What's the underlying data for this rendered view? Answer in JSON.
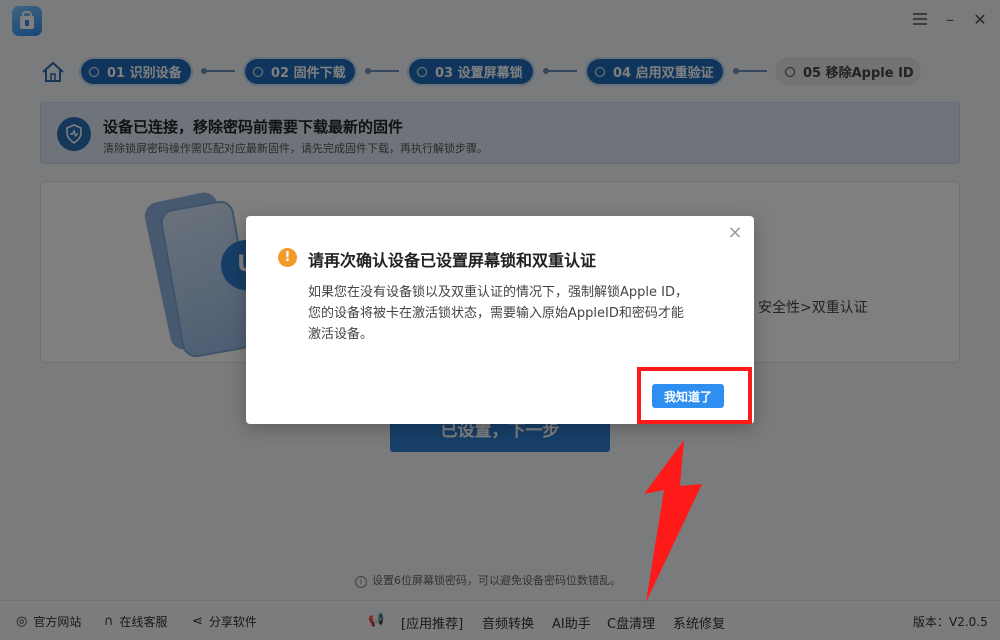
{
  "window": {
    "minimize": "–",
    "close": "✕"
  },
  "steps": [
    {
      "label": "01 识别设备",
      "state": "done"
    },
    {
      "label": "02 固件下载",
      "state": "done"
    },
    {
      "label": "03 设置屏幕锁",
      "state": "done"
    },
    {
      "label": "04 启用双重验证",
      "state": "done"
    },
    {
      "label": "05 移除Apple ID",
      "state": "todo"
    }
  ],
  "banner": {
    "title": "设备已连接，移除密码前需要下载最新的固件",
    "subtitle": "清除锁屏密码操作需匹配对应最新固件，请先完成固件下载，再执行解锁步骤。"
  },
  "card": {
    "tail_text": "安全性>双重认证"
  },
  "next_button": "已设置，下一步",
  "tip": "设置6位屏幕锁密码，可以避免设备密码位数错乱。",
  "footer": {
    "official_site": "官方网站",
    "online_support": "在线客服",
    "share": "分享软件",
    "recommend": "[应用推荐]",
    "audio_convert": "音频转换",
    "ai_assistant": "AI助手",
    "c_clean": "C盘清理",
    "system_repair": "系统修复",
    "version": "版本：V2.0.5"
  },
  "dialog": {
    "close": "×",
    "warn": "!",
    "title": "请再次确认设备已设置屏幕锁和双重认证",
    "body": [
      "如果您在没有设备锁以及双重认证的情况下，强制解锁Apple ID，",
      "您的设备将被卡在激活锁状态，需要输入原始AppleID和密码才能",
      "激活设备。"
    ],
    "ok": "我知道了"
  },
  "colors": {
    "accent": "#2f8ff0",
    "step_done": "#1f6bb8",
    "annotation": "#ff1a1a",
    "warning": "#f39a2b"
  }
}
